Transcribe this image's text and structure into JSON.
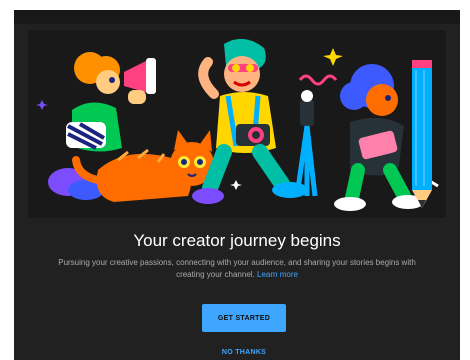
{
  "dialog": {
    "title": "Your creator journey begins",
    "body": "Pursuing your creative passions, connecting with your audience, and sharing your stories begins with creating your channel.",
    "learn_more": "Learn more",
    "get_started": "GET STARTED",
    "no_thanks": "NO THANKS"
  },
  "colors": {
    "background": "#212121",
    "accent": "#3ea6ff",
    "title": "#ffffff",
    "body": "#aaaaaa"
  }
}
